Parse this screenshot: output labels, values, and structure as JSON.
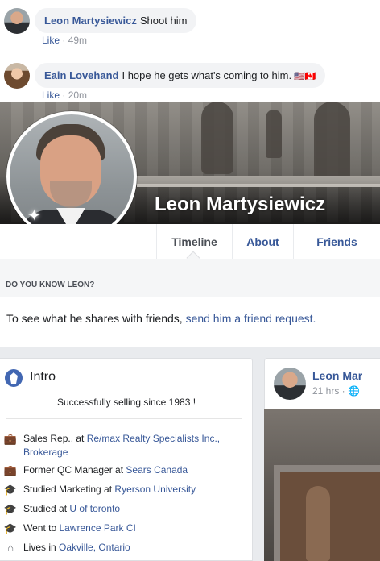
{
  "comments": [
    {
      "author": "Leon Martysiewicz",
      "text": "Shoot him",
      "like_label": "Like",
      "time": "49m"
    },
    {
      "author": "Eain Lovehand",
      "text": "I hope he gets what's coming to him.",
      "flags": "🇺🇸🇨🇦",
      "like_label": "Like",
      "time": "20m"
    }
  ],
  "profile": {
    "name": "Leon Martysiewicz"
  },
  "tabs": [
    {
      "label": "Timeline"
    },
    {
      "label": "About"
    },
    {
      "label": "Friends"
    }
  ],
  "know": {
    "header": "DO YOU KNOW LEON?",
    "text": "To see what he shares with friends,",
    "link": "send him a friend request."
  },
  "intro": {
    "title": "Intro",
    "bio": "Successfully selling since 1983 !",
    "items": [
      {
        "icon": "briefcase-icon",
        "prefix": "Sales Rep., at",
        "link": "Re/max Realty Specialists Inc., Brokerage"
      },
      {
        "icon": "briefcase-icon",
        "prefix": "Former QC Manager at",
        "link": "Sears Canada"
      },
      {
        "icon": "graduation-cap-icon",
        "prefix": "Studied Marketing at",
        "link": "Ryerson University"
      },
      {
        "icon": "graduation-cap-icon",
        "prefix": "Studied at",
        "link": "U of toronto"
      },
      {
        "icon": "graduation-cap-icon",
        "prefix": "Went to",
        "link": "Lawrence Park CI"
      },
      {
        "icon": "home-icon",
        "prefix": "Lives in",
        "link": "Oakville, Ontario"
      }
    ]
  },
  "post": {
    "author": "Leon Mar",
    "time": "21 hrs · 🌐"
  },
  "colors": {
    "link": "#385898",
    "bubble": "#f2f3f5",
    "page_bg": "#e9ebee"
  }
}
